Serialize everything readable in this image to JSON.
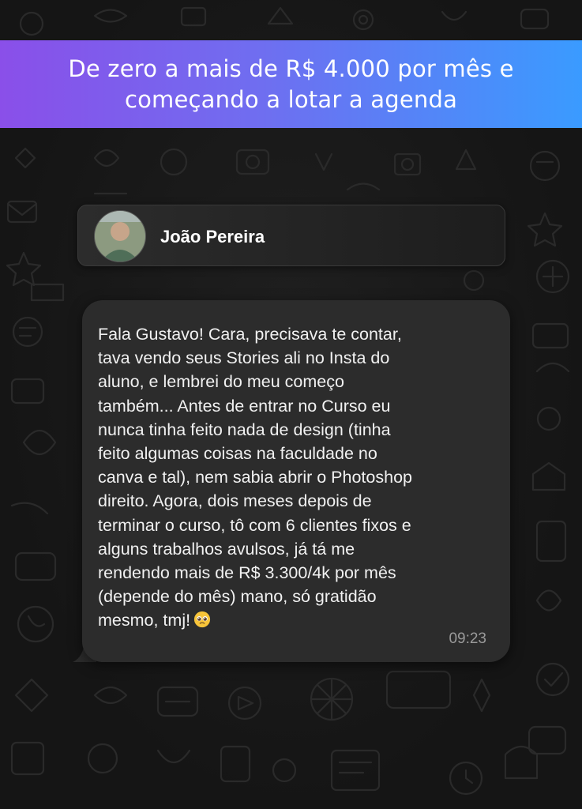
{
  "banner": {
    "title": "De zero a mais de R$ 4.000 por mês e começando a lotar a agenda"
  },
  "chat": {
    "contact_name": "João Pereira",
    "message": "Fala Gustavo! Cara, precisava te contar,\ntava vendo seus Stories ali no Insta do\naluno, e lembrei do meu começo\ntambém... Antes de entrar no Curso eu\nnunca tinha feito nada de design (tinha\nfeito algumas coisas na faculdade no\ncanva e tal), nem sabia abrir o Photoshop\ndireito. Agora, dois meses depois de\nterminar o curso, tô com 6 clientes fixos e\nalguns trabalhos avulsos, já tá me\nrendendo mais de R$ 3.300/4k por mês\n(depende do mês) mano, só gratidão\nmesmo, tmj!",
    "emoji": "pleading-face",
    "time": "09:23"
  },
  "colors": {
    "banner_gradient_start": "#8a4fe9",
    "banner_gradient_end": "#3a9bff",
    "bubble": "#2c2c2c",
    "background": "#151515"
  }
}
